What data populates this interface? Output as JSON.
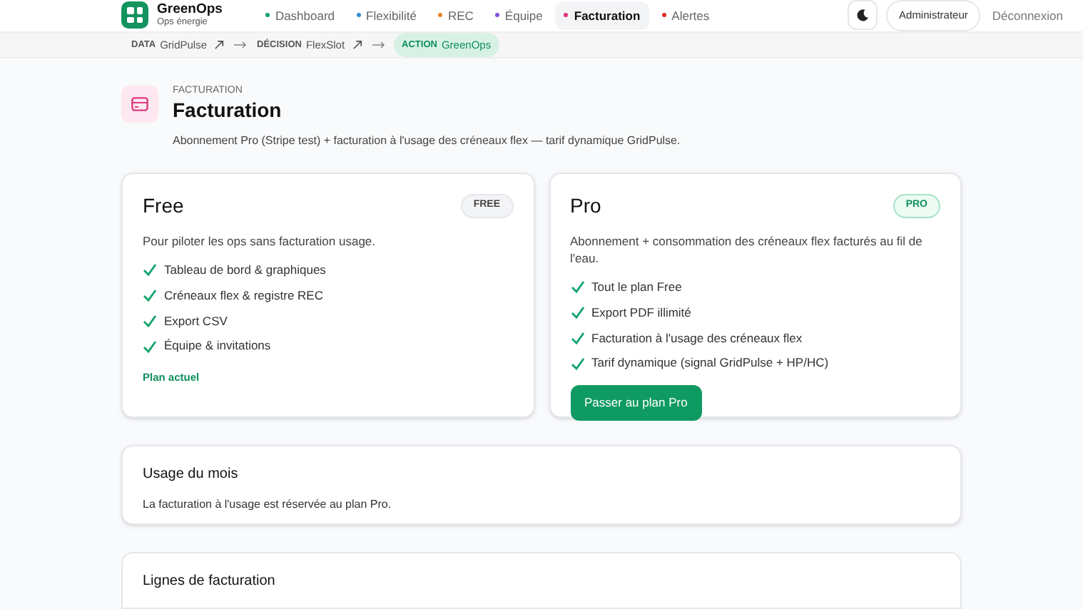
{
  "brand": {
    "name": "GreenOps",
    "subtitle": "Ops énergie"
  },
  "nav": [
    {
      "label": "Dashboard",
      "color": "#10a36b",
      "selected": false
    },
    {
      "label": "Flexibilité",
      "color": "#2b8fd6",
      "selected": false
    },
    {
      "label": "REC",
      "color": "#e8842a",
      "selected": false
    },
    {
      "label": "Équipe",
      "color": "#8b4fe0",
      "selected": false
    },
    {
      "label": "Facturation",
      "color": "#e0307a",
      "selected": true
    },
    {
      "label": "Alertes",
      "color": "#e02a2a",
      "selected": false
    }
  ],
  "user": {
    "role": "Administrateur",
    "logout": "Déconnexion"
  },
  "pipeline": [
    {
      "tag": "DATA",
      "name": "GridPulse",
      "external": true,
      "selected": false
    },
    {
      "tag": "DÉCISION",
      "name": "FlexSlot",
      "external": true,
      "selected": false
    },
    {
      "tag": "ACTION",
      "name": "GreenOps",
      "external": false,
      "selected": true
    }
  ],
  "page": {
    "eyebrow": "FACTURATION",
    "title": "Facturation",
    "description": "Abonnement Pro (Stripe test) + facturation à l'usage des créneaux flex — tarif dynamique GridPulse."
  },
  "plans": [
    {
      "kind": "free",
      "name": "Free",
      "badge": "FREE",
      "description": "Pour piloter les ops sans facturation usage.",
      "features": [
        "Tableau de bord & graphiques",
        "Créneaux flex & registre REC",
        "Export CSV",
        "Équipe & invitations"
      ],
      "action": "Plan actuel"
    },
    {
      "kind": "pro",
      "name": "Pro",
      "badge": "PRO",
      "description": "Abonnement + consommation des créneaux flex facturés au fil de l'eau.",
      "features": [
        "Tout le plan Free",
        "Export PDF illimité",
        "Facturation à l'usage des créneaux flex",
        "Tarif dynamique (signal GridPulse + HP/HC)"
      ],
      "action": "Passer au plan Pro"
    }
  ],
  "usage": {
    "title": "Usage du mois",
    "message": "La facturation à l'usage est réservée au plan Pro."
  },
  "invoice_lines": {
    "title": "Lignes de facturation"
  }
}
